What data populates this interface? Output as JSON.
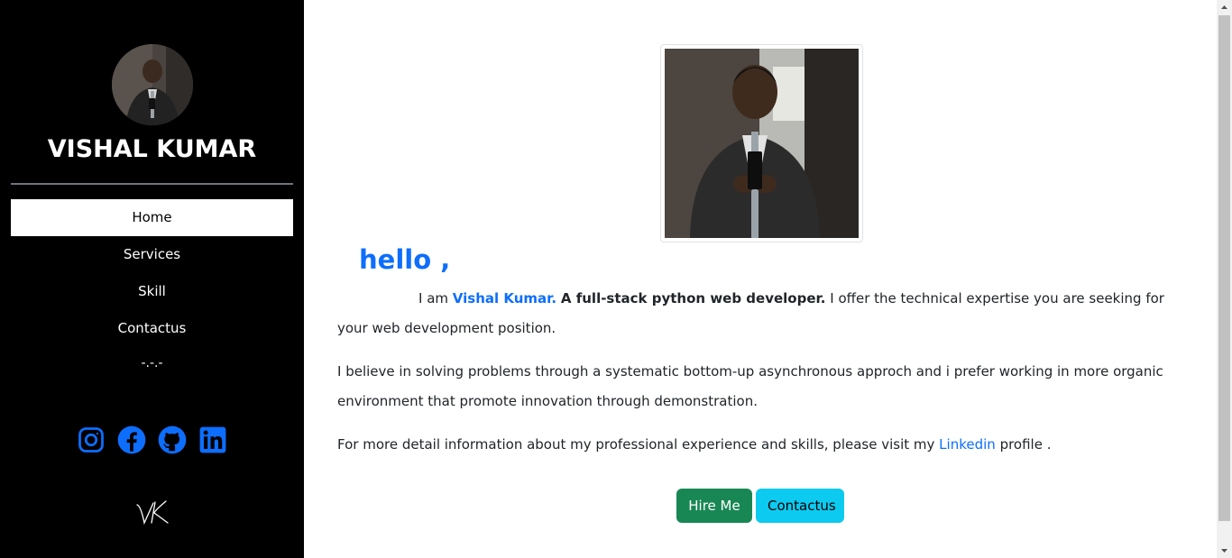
{
  "sidebar": {
    "name": "VISHAL KUMAR",
    "nav": [
      {
        "label": "Home",
        "active": true
      },
      {
        "label": "Services",
        "active": false
      },
      {
        "label": "Skill",
        "active": false
      },
      {
        "label": "Contactus",
        "active": false
      }
    ],
    "separator": "-.-.-",
    "socials": [
      "instagram-icon",
      "facebook-icon",
      "github-icon",
      "linkedin-icon"
    ],
    "social_color": "#0d6efd",
    "logo_text": "VK"
  },
  "main": {
    "greeting": "hello ,",
    "intro_prefix": "I am",
    "intro_name": "Vishal Kumar.",
    "intro_role": "A full-stack python web developer.",
    "intro_rest": "I offer the technical expertise you are seeking for your web development position.",
    "para2": "I believe in solving problems through a systematic bottom-up asynchronous approch and i prefer working in more organic environment that promote innovation through demonstration.",
    "para3_prefix": "For more detail information about my professional experience and skills, please visit my",
    "para3_link": "Linkedin",
    "para3_suffix": "profile .",
    "buttons": {
      "hire": "Hire Me",
      "contact": "Contactus"
    }
  },
  "colors": {
    "accent": "#0d6efd",
    "sidebar_bg": "#000000",
    "hire_btn": "#198754",
    "contact_btn": "#0dcaf0"
  }
}
